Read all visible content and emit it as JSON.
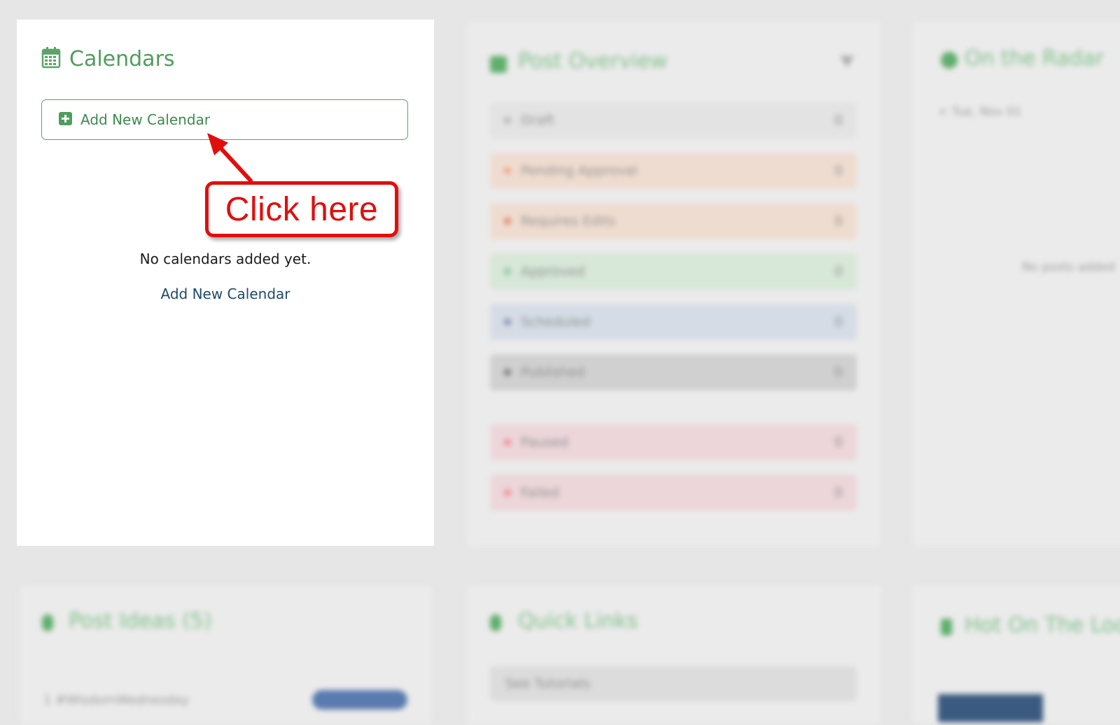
{
  "calendars_card": {
    "title": "Calendars",
    "add_button_label": "Add New Calendar",
    "empty_message": "No calendars added yet.",
    "add_link_label": "Add New Calendar"
  },
  "annotation": {
    "callout_text": "Click here",
    "color": "#e10e0e"
  },
  "post_overview": {
    "title": "Post Overview",
    "statuses": [
      {
        "label": "Draft",
        "count": "0",
        "color": "#e3e3e3",
        "dot": "#b5b5b5"
      },
      {
        "label": "Pending Approval",
        "count": "0",
        "color": "#efdcd0",
        "dot": "#f0a07a"
      },
      {
        "label": "Requires Edits",
        "count": "0",
        "color": "#efdcd0",
        "dot": "#e08060"
      },
      {
        "label": "Approved",
        "count": "0",
        "color": "#d7e7d8",
        "dot": "#8cc79a"
      },
      {
        "label": "Scheduled",
        "count": "0",
        "color": "#d6dce6",
        "dot": "#7f8fb0"
      },
      {
        "label": "Published",
        "count": "0",
        "color": "#d0d0d0",
        "dot": "#777777"
      },
      {
        "label": "Paused",
        "count": "0",
        "color": "#ecd6da",
        "dot": "#f08a8a"
      },
      {
        "label": "Failed",
        "count": "0",
        "color": "#ecd6da",
        "dot": "#f08a8a"
      }
    ]
  },
  "on_the_radar": {
    "title": "On the Radar",
    "date": "< Tue, Nov 01",
    "empty_message": "No posts added"
  },
  "post_ideas": {
    "title": "Post Ideas (5)",
    "first_item": "1  #WisdomWednesday"
  },
  "quick_links": {
    "title": "Quick Links",
    "first_item": "See Tutorials"
  },
  "hot_on_the_loop": {
    "title": "Hot On The Loo"
  }
}
